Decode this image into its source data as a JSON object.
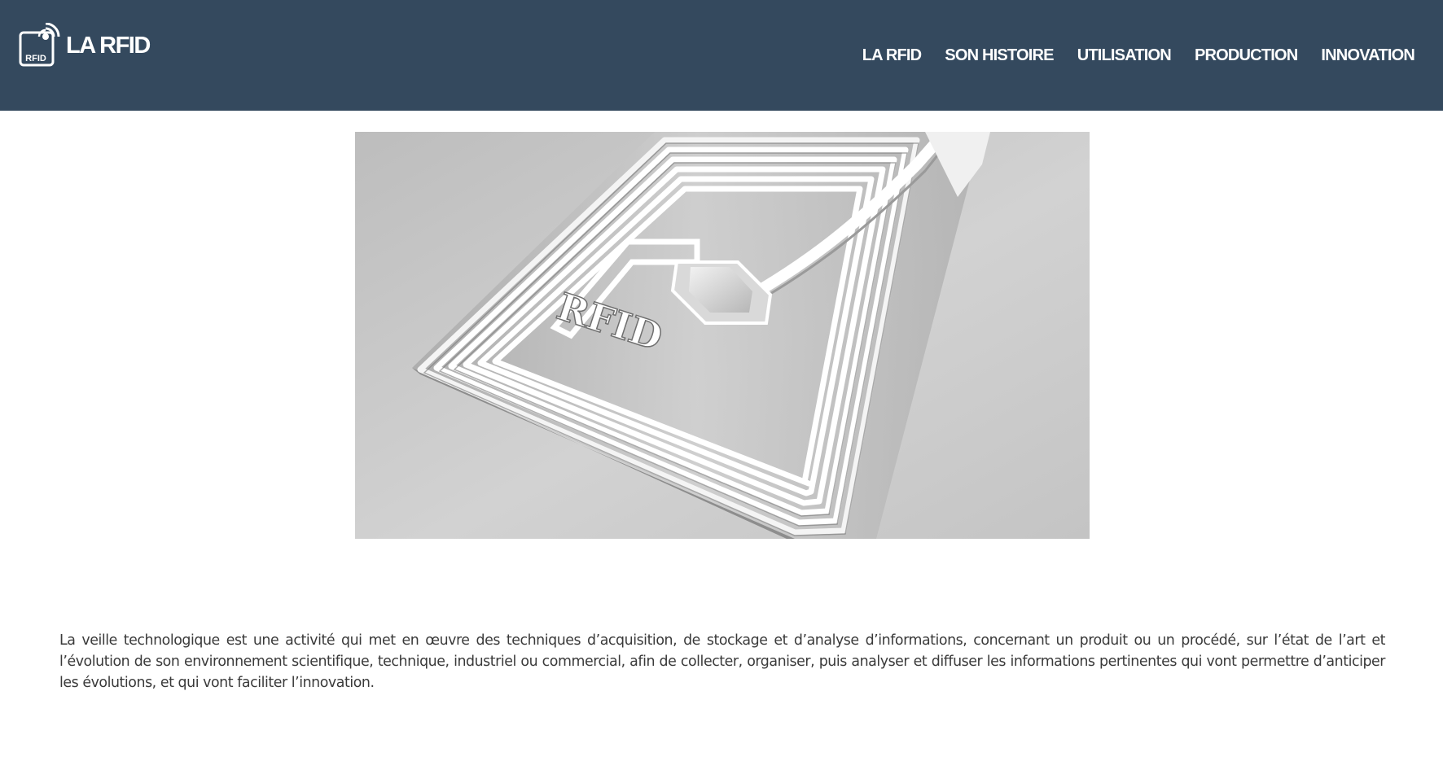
{
  "header": {
    "logo_icon": "rfid-tag-icon",
    "logo_badge_text": "RFID",
    "brand_title": "LA RFID",
    "background_color": "#34495e"
  },
  "nav": {
    "items": [
      {
        "label": "LA RFID"
      },
      {
        "label": "SON HISTOIRE"
      },
      {
        "label": "UTILISATION"
      },
      {
        "label": "PRODUCTION"
      },
      {
        "label": "INNOVATION"
      }
    ]
  },
  "hero": {
    "tag_text": "RFID"
  },
  "content": {
    "intro_text": "La veille technologique est une activité qui met en œuvre des techniques d’acquisition, de stockage et d’analyse d’informations, concernant un produit ou un procédé, sur l’état de l’art et l’évolution de son environnement scientifique, technique, industriel ou commercial, afin de collecter, organiser, puis analyser et diffuser les informations pertinentes qui vont permettre d’anticiper les évolutions, et qui vont faciliter l’innovation."
  }
}
